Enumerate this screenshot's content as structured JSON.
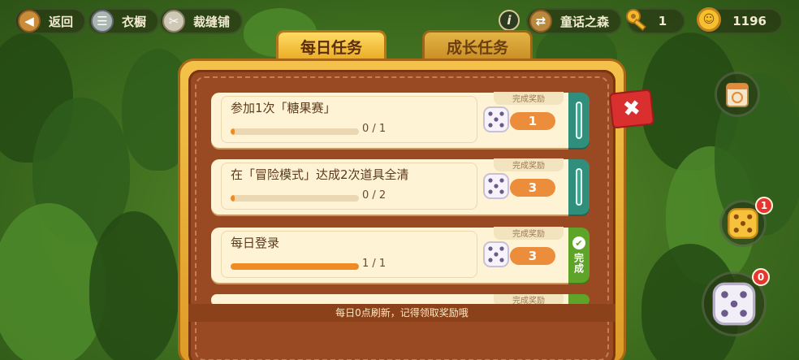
{
  "header": {
    "back_label": "返回",
    "wardrobe_label": "衣橱",
    "tailor_label": "裁缝铺",
    "location_label": "童话之森",
    "keys": "1",
    "coins": "1196"
  },
  "tabs": [
    {
      "label": "每日任务",
      "active": true
    },
    {
      "label": "成长任务",
      "active": false
    }
  ],
  "tasks": [
    {
      "title": "参加1次「糖果赛」",
      "progress_text": "0 / 1",
      "progress": 0.0,
      "reward_label": "完成奖励",
      "reward_amount": "1",
      "status": "go"
    },
    {
      "title": "在「冒险模式」达成2次道具全清",
      "progress_text": "0 / 2",
      "progress": 0.0,
      "reward_label": "完成奖励",
      "reward_amount": "3",
      "status": "go"
    },
    {
      "title": "每日登录",
      "progress_text": "1 / 1",
      "progress": 1.0,
      "reward_label": "完成奖励",
      "reward_amount": "3",
      "status": "done",
      "done_label": "完成"
    },
    {
      "title": "",
      "reward_label": "完成奖励",
      "status": "done"
    }
  ],
  "footer_note": "每日0点刷新，记得领取奖励哦",
  "right_buttons": {
    "dice_gold_badge": "1",
    "dice_white_badge": "0"
  },
  "colors": {
    "tab_active": "#e9a922",
    "progress_fill": "#f08a24",
    "go_button": "#2f8f7c",
    "done_button": "#5ea428",
    "close_button": "#d9302f"
  }
}
